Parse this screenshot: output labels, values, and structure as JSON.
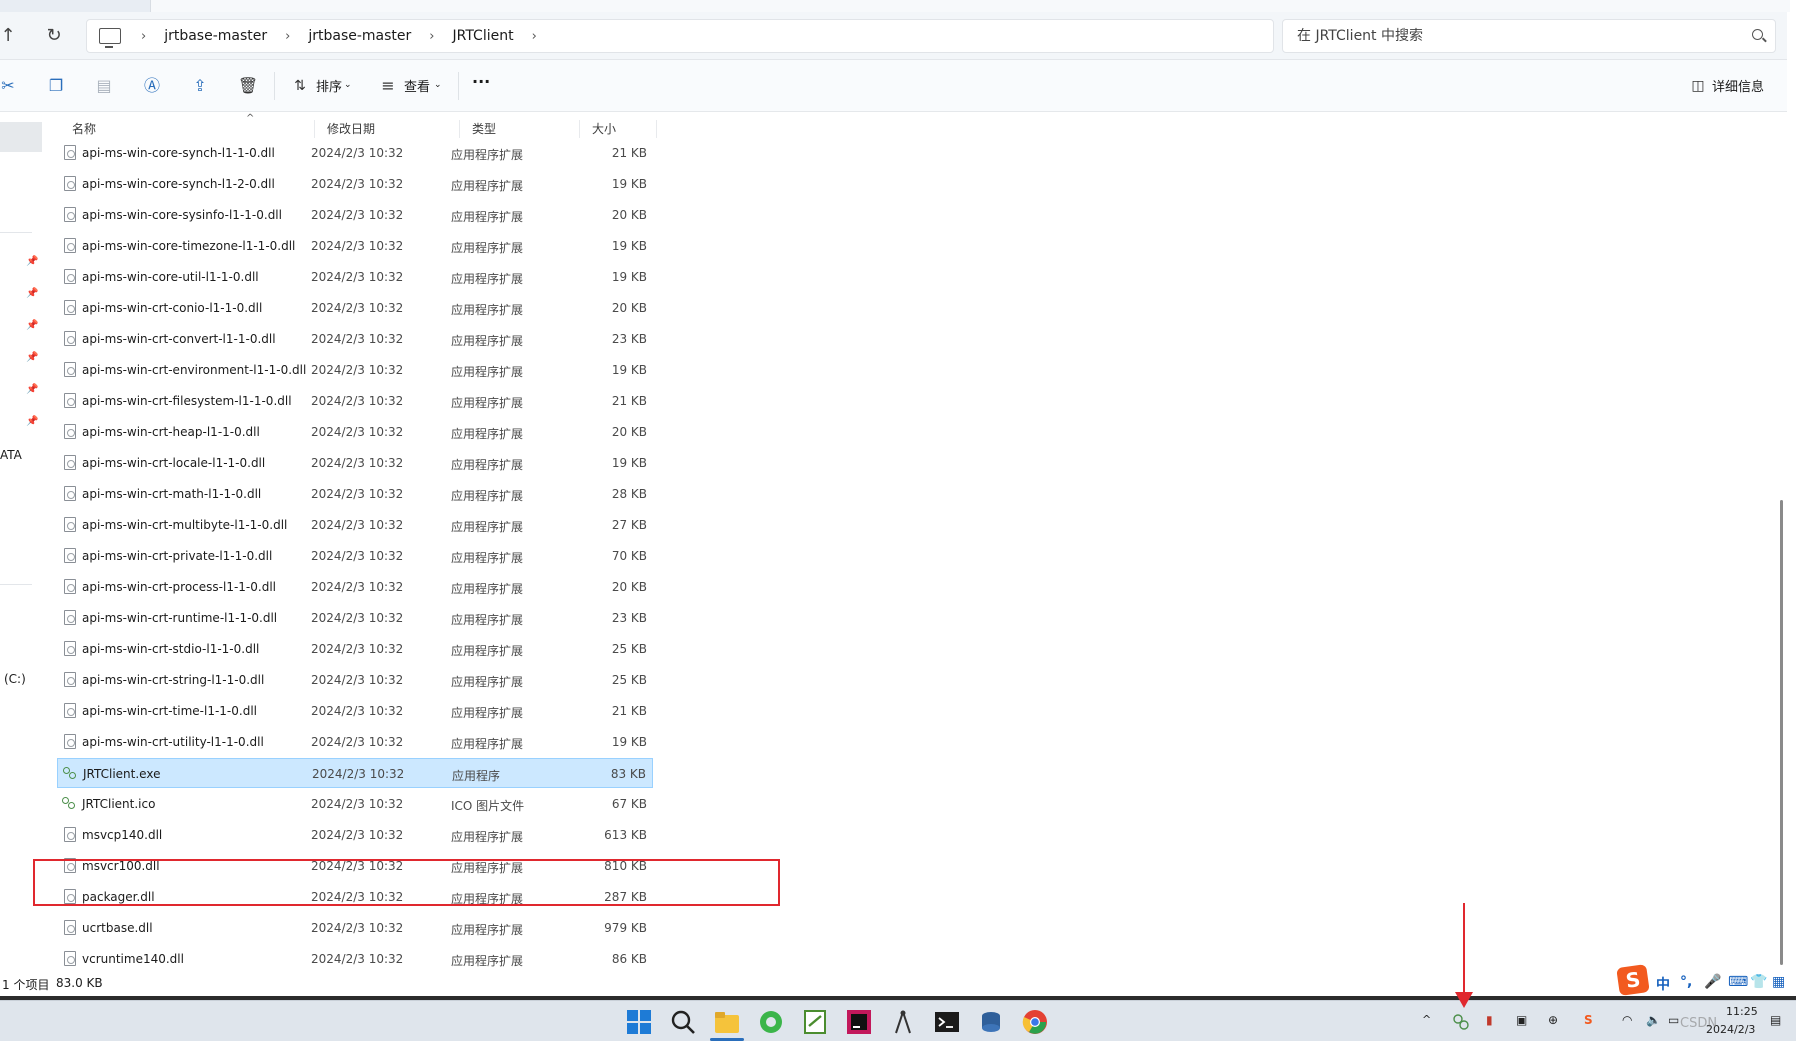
{
  "breadcrumbs": [
    "jrtbase-master",
    "jrtbase-master",
    "JRTClient"
  ],
  "search": {
    "placeholder": "在 JRTClient 中搜索"
  },
  "toolbar": {
    "sort_label": "排序",
    "view_label": "查看",
    "more_label": "···",
    "details_label": "详细信息"
  },
  "columns": {
    "name": "名称",
    "date": "修改日期",
    "type": "类型",
    "size": "大小"
  },
  "leftpane": {
    "ata_label": "ATA",
    "drive_label": "(C:)"
  },
  "files": [
    {
      "name": "api-ms-win-core-synch-l1-1-0.dll",
      "date": "2024/2/3 10:32",
      "type": "应用程序扩展",
      "size": "21 KB"
    },
    {
      "name": "api-ms-win-core-synch-l1-2-0.dll",
      "date": "2024/2/3 10:32",
      "type": "应用程序扩展",
      "size": "19 KB"
    },
    {
      "name": "api-ms-win-core-sysinfo-l1-1-0.dll",
      "date": "2024/2/3 10:32",
      "type": "应用程序扩展",
      "size": "20 KB"
    },
    {
      "name": "api-ms-win-core-timezone-l1-1-0.dll",
      "date": "2024/2/3 10:32",
      "type": "应用程序扩展",
      "size": "19 KB"
    },
    {
      "name": "api-ms-win-core-util-l1-1-0.dll",
      "date": "2024/2/3 10:32",
      "type": "应用程序扩展",
      "size": "19 KB"
    },
    {
      "name": "api-ms-win-crt-conio-l1-1-0.dll",
      "date": "2024/2/3 10:32",
      "type": "应用程序扩展",
      "size": "20 KB"
    },
    {
      "name": "api-ms-win-crt-convert-l1-1-0.dll",
      "date": "2024/2/3 10:32",
      "type": "应用程序扩展",
      "size": "23 KB"
    },
    {
      "name": "api-ms-win-crt-environment-l1-1-0.dll",
      "date": "2024/2/3 10:32",
      "type": "应用程序扩展",
      "size": "19 KB"
    },
    {
      "name": "api-ms-win-crt-filesystem-l1-1-0.dll",
      "date": "2024/2/3 10:32",
      "type": "应用程序扩展",
      "size": "21 KB"
    },
    {
      "name": "api-ms-win-crt-heap-l1-1-0.dll",
      "date": "2024/2/3 10:32",
      "type": "应用程序扩展",
      "size": "20 KB"
    },
    {
      "name": "api-ms-win-crt-locale-l1-1-0.dll",
      "date": "2024/2/3 10:32",
      "type": "应用程序扩展",
      "size": "19 KB"
    },
    {
      "name": "api-ms-win-crt-math-l1-1-0.dll",
      "date": "2024/2/3 10:32",
      "type": "应用程序扩展",
      "size": "28 KB"
    },
    {
      "name": "api-ms-win-crt-multibyte-l1-1-0.dll",
      "date": "2024/2/3 10:32",
      "type": "应用程序扩展",
      "size": "27 KB"
    },
    {
      "name": "api-ms-win-crt-private-l1-1-0.dll",
      "date": "2024/2/3 10:32",
      "type": "应用程序扩展",
      "size": "70 KB"
    },
    {
      "name": "api-ms-win-crt-process-l1-1-0.dll",
      "date": "2024/2/3 10:32",
      "type": "应用程序扩展",
      "size": "20 KB"
    },
    {
      "name": "api-ms-win-crt-runtime-l1-1-0.dll",
      "date": "2024/2/3 10:32",
      "type": "应用程序扩展",
      "size": "23 KB"
    },
    {
      "name": "api-ms-win-crt-stdio-l1-1-0.dll",
      "date": "2024/2/3 10:32",
      "type": "应用程序扩展",
      "size": "25 KB"
    },
    {
      "name": "api-ms-win-crt-string-l1-1-0.dll",
      "date": "2024/2/3 10:32",
      "type": "应用程序扩展",
      "size": "25 KB"
    },
    {
      "name": "api-ms-win-crt-time-l1-1-0.dll",
      "date": "2024/2/3 10:32",
      "type": "应用程序扩展",
      "size": "21 KB"
    },
    {
      "name": "api-ms-win-crt-utility-l1-1-0.dll",
      "date": "2024/2/3 10:32",
      "type": "应用程序扩展",
      "size": "19 KB"
    },
    {
      "name": "JRTClient.exe",
      "date": "2024/2/3 10:32",
      "type": "应用程序",
      "size": "83 KB"
    },
    {
      "name": "JRTClient.ico",
      "date": "2024/2/3 10:32",
      "type": "ICO 图片文件",
      "size": "67 KB"
    },
    {
      "name": "msvcp140.dll",
      "date": "2024/2/3 10:32",
      "type": "应用程序扩展",
      "size": "613 KB"
    },
    {
      "name": "msvcr100.dll",
      "date": "2024/2/3 10:32",
      "type": "应用程序扩展",
      "size": "810 KB"
    },
    {
      "name": "packager.dll",
      "date": "2024/2/3 10:32",
      "type": "应用程序扩展",
      "size": "287 KB"
    },
    {
      "name": "ucrtbase.dll",
      "date": "2024/2/3 10:32",
      "type": "应用程序扩展",
      "size": "979 KB"
    },
    {
      "name": "vcruntime140.dll",
      "date": "2024/2/3 10:32",
      "type": "应用程序扩展",
      "size": "86 KB"
    }
  ],
  "status": {
    "selection": "1 个项目",
    "size": "83.0 KB"
  },
  "ime": {
    "lang": "中",
    "punct": "°,"
  },
  "clock": {
    "time": "11:25",
    "date": "2024/2/3"
  },
  "watermark": "CSDN",
  "colors": {
    "selection_bg": "#cce8ff",
    "selection_border": "#99d1ff",
    "annotation_red": "#e0282e",
    "accent_blue": "#2a6ebb"
  }
}
